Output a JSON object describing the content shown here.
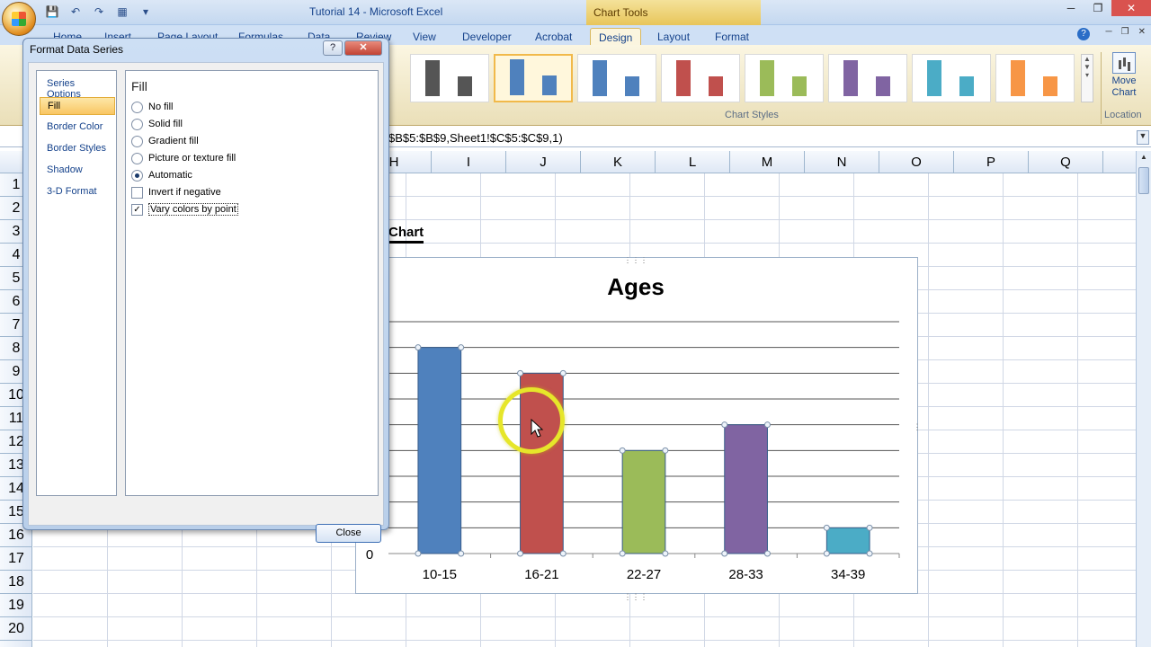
{
  "window": {
    "title": "Tutorial 14 - Microsoft Excel",
    "contextual_tab_group": "Chart Tools"
  },
  "ribbon": {
    "tabs": [
      {
        "label": "Home"
      },
      {
        "label": "Insert"
      },
      {
        "label": "Page Layout"
      },
      {
        "label": "Formulas"
      },
      {
        "label": "Data"
      },
      {
        "label": "Review"
      },
      {
        "label": "View"
      },
      {
        "label": "Developer"
      },
      {
        "label": "Acrobat"
      },
      {
        "label": "Design"
      },
      {
        "label": "Layout"
      },
      {
        "label": "Format"
      }
    ],
    "active_tab": "Design",
    "chart_styles_label": "Chart Styles",
    "location_label": "Location",
    "move_chart_line1": "Move",
    "move_chart_line2": "Chart",
    "style_colors": [
      "#555555",
      "#4f81bd",
      "#4f81bd",
      "#c0504d",
      "#9bbb59",
      "#8064a2",
      "#4bacc6",
      "#f79646"
    ]
  },
  "formula_bar": {
    "text": "$B$5:$B$9,Sheet1!$C$5:$C$9,1)"
  },
  "sheet": {
    "columns": [
      "H",
      "I",
      "J",
      "K",
      "L",
      "M",
      "N",
      "O",
      "P",
      "Q"
    ],
    "rows": [
      "1",
      "2",
      "3",
      "4",
      "5",
      "6",
      "7",
      "8",
      "9",
      "10",
      "11",
      "12",
      "13",
      "14",
      "15",
      "16",
      "17",
      "18",
      "19",
      "20"
    ],
    "chart_label": "Chart"
  },
  "chart_data": {
    "type": "bar",
    "title": "Ages",
    "categories": [
      "10-15",
      "16-21",
      "22-27",
      "28-33",
      "34-39"
    ],
    "values": [
      8,
      7,
      4,
      5,
      1
    ],
    "colors": [
      "#4f81bd",
      "#c0504d",
      "#9bbb59",
      "#8064a2",
      "#4bacc6"
    ],
    "ylim": [
      0,
      9
    ],
    "y_tick_labels_visible": [
      "0"
    ],
    "grid": true,
    "legend": "none"
  },
  "dialog": {
    "title": "Format Data Series",
    "help_label": "?",
    "close_x": "✕",
    "categories": [
      "Series Options",
      "Fill",
      "Border Color",
      "Border Styles",
      "Shadow",
      "3-D Format"
    ],
    "active_category": "Fill",
    "heading": "Fill",
    "fill_options": [
      {
        "label": "No fill",
        "checked": false
      },
      {
        "label": "Solid fill",
        "checked": false
      },
      {
        "label": "Gradient fill",
        "checked": false
      },
      {
        "label": "Picture or texture fill",
        "checked": false
      },
      {
        "label": "Automatic",
        "checked": true
      }
    ],
    "invert_if_negative": {
      "label": "Invert if negative",
      "checked": false
    },
    "vary_colors_by_point": {
      "label": "Vary colors by point",
      "checked": true
    },
    "close_button": "Close"
  }
}
